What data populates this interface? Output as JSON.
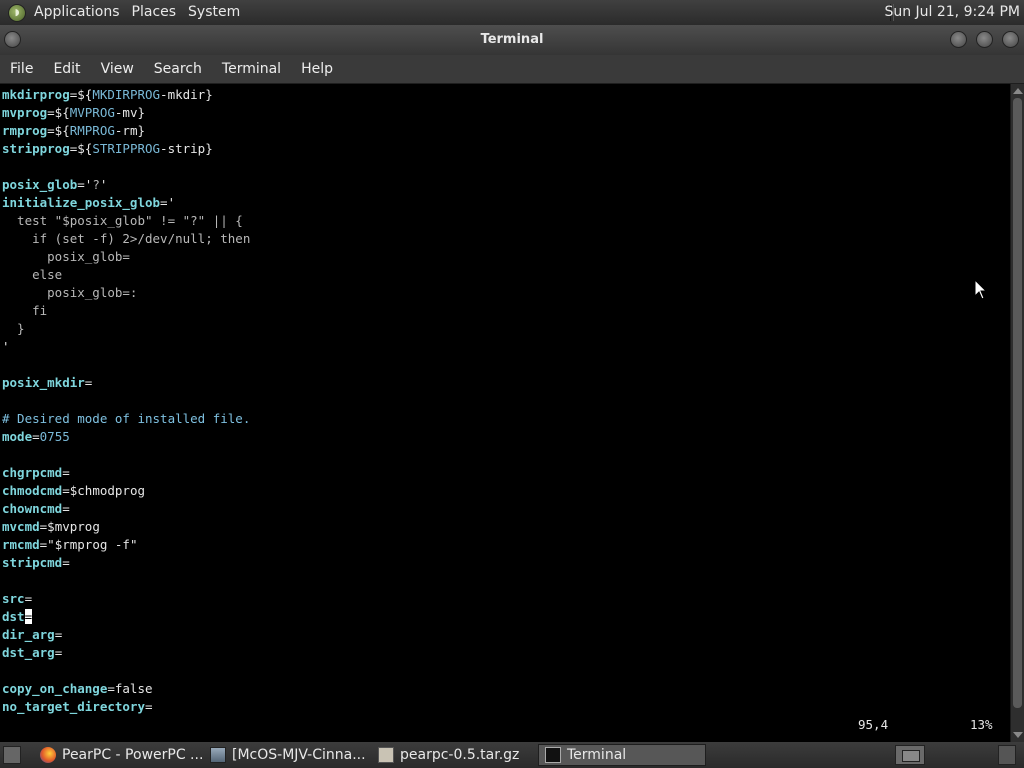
{
  "top_panel": {
    "menus": [
      "Applications",
      "Places",
      "System"
    ],
    "clock": "Sun Jul 21,  9:24 PM"
  },
  "window": {
    "title": "Terminal"
  },
  "menubar": [
    "File",
    "Edit",
    "View",
    "Search",
    "Terminal",
    "Help"
  ],
  "terminal": {
    "lines": [
      [
        {
          "t": "mkdirprog",
          "c": "v"
        },
        {
          "t": "=${",
          "c": "d"
        },
        {
          "t": "MKDIRPROG",
          "c": "vx"
        },
        {
          "t": "-mkdir}",
          "c": "d"
        }
      ],
      [
        {
          "t": "mvprog",
          "c": "v"
        },
        {
          "t": "=${",
          "c": "d"
        },
        {
          "t": "MVPROG",
          "c": "vx"
        },
        {
          "t": "-mv}",
          "c": "d"
        }
      ],
      [
        {
          "t": "rmprog",
          "c": "v"
        },
        {
          "t": "=${",
          "c": "d"
        },
        {
          "t": "RMPROG",
          "c": "vx"
        },
        {
          "t": "-rm}",
          "c": "d"
        }
      ],
      [
        {
          "t": "stripprog",
          "c": "v"
        },
        {
          "t": "=${",
          "c": "d"
        },
        {
          "t": "STRIPPROG",
          "c": "vx"
        },
        {
          "t": "-strip}",
          "c": "d"
        }
      ],
      [],
      [
        {
          "t": "posix_glob",
          "c": "v"
        },
        {
          "t": "='",
          "c": "d"
        },
        {
          "t": "?",
          "c": "s"
        },
        {
          "t": "'",
          "c": "d"
        }
      ],
      [
        {
          "t": "initialize_posix_glob",
          "c": "v"
        },
        {
          "t": "='",
          "c": "d"
        }
      ],
      [
        {
          "t": "  test \"$posix_glob\" != \"?\" || {",
          "c": "s"
        }
      ],
      [
        {
          "t": "    if (set -f) 2>/dev/null; then",
          "c": "s"
        }
      ],
      [
        {
          "t": "      posix_glob=",
          "c": "s"
        }
      ],
      [
        {
          "t": "    else",
          "c": "s"
        }
      ],
      [
        {
          "t": "      posix_glob=:",
          "c": "s"
        }
      ],
      [
        {
          "t": "    fi",
          "c": "s"
        }
      ],
      [
        {
          "t": "  }",
          "c": "s"
        }
      ],
      [
        {
          "t": "'",
          "c": "d"
        }
      ],
      [],
      [
        {
          "t": "posix_mkdir",
          "c": "v"
        },
        {
          "t": "=",
          "c": "d"
        }
      ],
      [],
      [
        {
          "t": "# Desired mode of installed file.",
          "c": "c"
        }
      ],
      [
        {
          "t": "mode",
          "c": "v"
        },
        {
          "t": "=",
          "c": "d"
        },
        {
          "t": "0755",
          "c": "vx"
        }
      ],
      [],
      [
        {
          "t": "chgrpcmd",
          "c": "v"
        },
        {
          "t": "=",
          "c": "d"
        }
      ],
      [
        {
          "t": "chmodcmd",
          "c": "v"
        },
        {
          "t": "=$chmodprog",
          "c": "d"
        }
      ],
      [
        {
          "t": "chowncmd",
          "c": "v"
        },
        {
          "t": "=",
          "c": "d"
        }
      ],
      [
        {
          "t": "mvcmd",
          "c": "v"
        },
        {
          "t": "=$mvprog",
          "c": "d"
        }
      ],
      [
        {
          "t": "rmcmd",
          "c": "v"
        },
        {
          "t": "=\"$rmprog -f\"",
          "c": "d"
        }
      ],
      [
        {
          "t": "stripcmd",
          "c": "v"
        },
        {
          "t": "=",
          "c": "d"
        }
      ],
      [],
      [
        {
          "t": "src",
          "c": "v"
        },
        {
          "t": "=",
          "c": "d"
        }
      ],
      [
        {
          "t": "dst",
          "c": "v"
        },
        {
          "t": "=",
          "c": "cursor"
        }
      ],
      [
        {
          "t": "dir_arg",
          "c": "v"
        },
        {
          "t": "=",
          "c": "d"
        }
      ],
      [
        {
          "t": "dst_arg",
          "c": "v"
        },
        {
          "t": "=",
          "c": "d"
        }
      ],
      [],
      [
        {
          "t": "copy_on_change",
          "c": "v"
        },
        {
          "t": "=false",
          "c": "d"
        }
      ],
      [
        {
          "t": "no_target_directory",
          "c": "v"
        },
        {
          "t": "=",
          "c": "d"
        }
      ]
    ],
    "status_position": "95,4",
    "status_percent": "13%"
  },
  "taskbar": {
    "tasks": [
      {
        "label": "PearPC - PowerPC ...",
        "icon": "firefox-icon"
      },
      {
        "label": "[McOS-MJV-Cinna...",
        "icon": "screenshot-app-icon"
      },
      {
        "label": "pearpc-0.5.tar.gz",
        "icon": "archive-icon"
      },
      {
        "label": "Terminal",
        "icon": "terminal-icon",
        "active": true
      }
    ]
  },
  "colors": {
    "variable": "#7fd6dd",
    "comment": "#7ec0e0",
    "terminal_bg": "#000000",
    "panel_bg": "#333333"
  }
}
